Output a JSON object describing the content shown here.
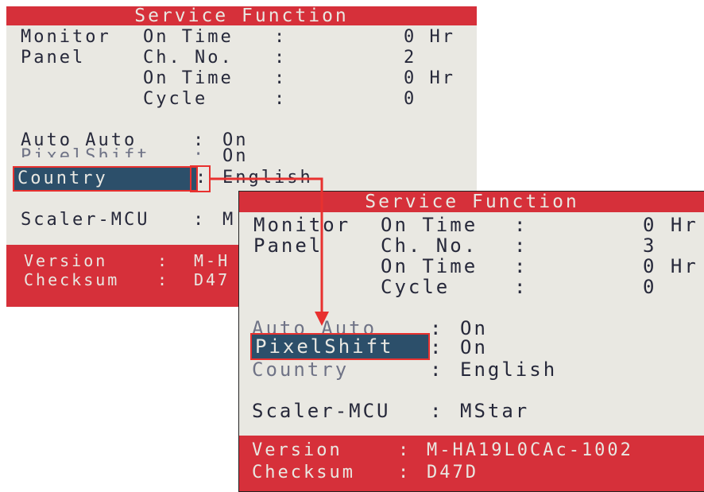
{
  "screen1": {
    "title": "Service Function",
    "monitor_label": "Monitor",
    "panel_label": "Panel",
    "rows": [
      {
        "name": "On Time",
        "sep": ":",
        "value": "0 Hr"
      },
      {
        "name": "Ch. No.",
        "sep": ":",
        "value": "2"
      },
      {
        "name": "On Time",
        "sep": ":",
        "value": "0 Hr"
      },
      {
        "name": "Cycle",
        "sep": ":",
        "value": "0"
      }
    ],
    "settings": [
      {
        "name": "Auto Auto",
        "sep": ":",
        "value": "On"
      },
      {
        "name": "PixelShift",
        "sep": ":",
        "value": "On"
      },
      {
        "name": "Country",
        "sep": ":",
        "value": "English"
      }
    ],
    "scaler": {
      "name": "Scaler-MCU",
      "sep": ":",
      "value": "M"
    },
    "version": {
      "name": "Version",
      "sep": ":",
      "value": "M-H"
    },
    "checksum": {
      "name": "Checksum",
      "sep": ":",
      "value": "D47"
    }
  },
  "screen2": {
    "title": "Service Function",
    "monitor_label": "Monitor",
    "panel_label": "Panel",
    "rows": [
      {
        "name": "On Time",
        "sep": ":",
        "value": "0 Hr"
      },
      {
        "name": "Ch. No.",
        "sep": ":",
        "value": "3"
      },
      {
        "name": "On Time",
        "sep": ":",
        "value": "0 Hr"
      },
      {
        "name": "Cycle",
        "sep": ":",
        "value": "0"
      }
    ],
    "settings": [
      {
        "name": "Auto Auto",
        "sep": ":",
        "value": "On"
      },
      {
        "name": "PixelShift",
        "sep": ":",
        "value": "On"
      },
      {
        "name": "Country",
        "sep": ":",
        "value": "English"
      }
    ],
    "scaler": {
      "name": "Scaler-MCU",
      "sep": ":",
      "value": "MStar"
    },
    "version": {
      "name": "Version",
      "sep": ":",
      "value": "M-HA19L0CAc-1002"
    },
    "checksum": {
      "name": "Checksum",
      "sep": ":",
      "value": "D47D"
    }
  },
  "colors": {
    "osd_bg": "#e9e8e2",
    "header_red": "#d6303a",
    "selection": "#2c4f6a",
    "highlight_border": "#e8312f"
  }
}
